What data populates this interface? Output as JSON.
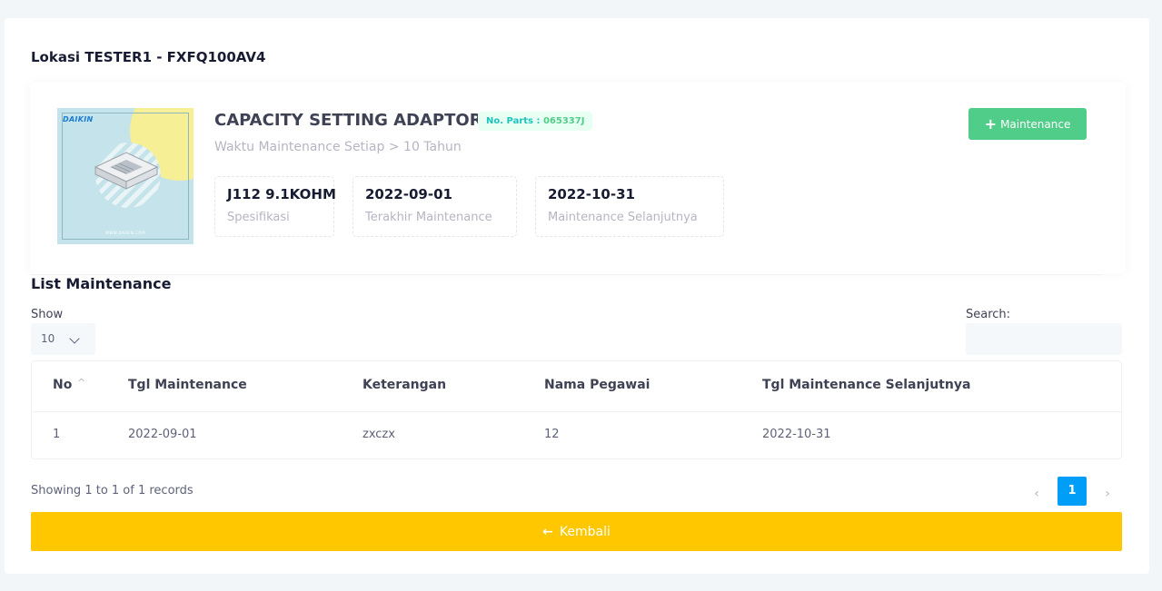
{
  "page": {
    "title": "Lokasi TESTER1 - FXFQ100AV4"
  },
  "product": {
    "brand": "DAIKIN",
    "image_url_text": "WWW.DAIKIN.COM",
    "name": "CAPACITY SETTING ADAPTOR",
    "parts_prefix": "No. Parts :",
    "parts_number": "065337J",
    "interval": "Waktu Maintenance Setiap > 10 Tahun",
    "stats": [
      {
        "value": "J112 9.1KOHM",
        "label": "Spesifikasi"
      },
      {
        "value": "2022-09-01",
        "label": "Terakhir Maintenance"
      },
      {
        "value": "2022-10-31",
        "label": "Maintenance Selanjutnya"
      }
    ],
    "add_button_label": "Maintenance",
    "add_button_icon": "plus-icon"
  },
  "list": {
    "title": "List Maintenance",
    "show_label": "Show",
    "show_value": "10",
    "search_label": "Search:",
    "search_value": "",
    "columns": [
      "No",
      "Tgl Maintenance",
      "Keterangan",
      "Nama Pegawai",
      "Tgl Maintenance Selanjutnya"
    ],
    "rows": [
      [
        "1",
        "2022-09-01",
        "zxczx",
        "12",
        "2022-10-31"
      ]
    ],
    "info": "Showing 1 to 1 of 1 records",
    "pagination": {
      "prev": "‹",
      "current": "1",
      "next": "›"
    }
  },
  "back_button": {
    "label": "Kembali",
    "icon": "arrow-left-icon"
  },
  "colors": {
    "success": "#50cd89",
    "primary": "#009ef7",
    "warning": "#ffc700",
    "badge_bg": "#e8fff3"
  }
}
